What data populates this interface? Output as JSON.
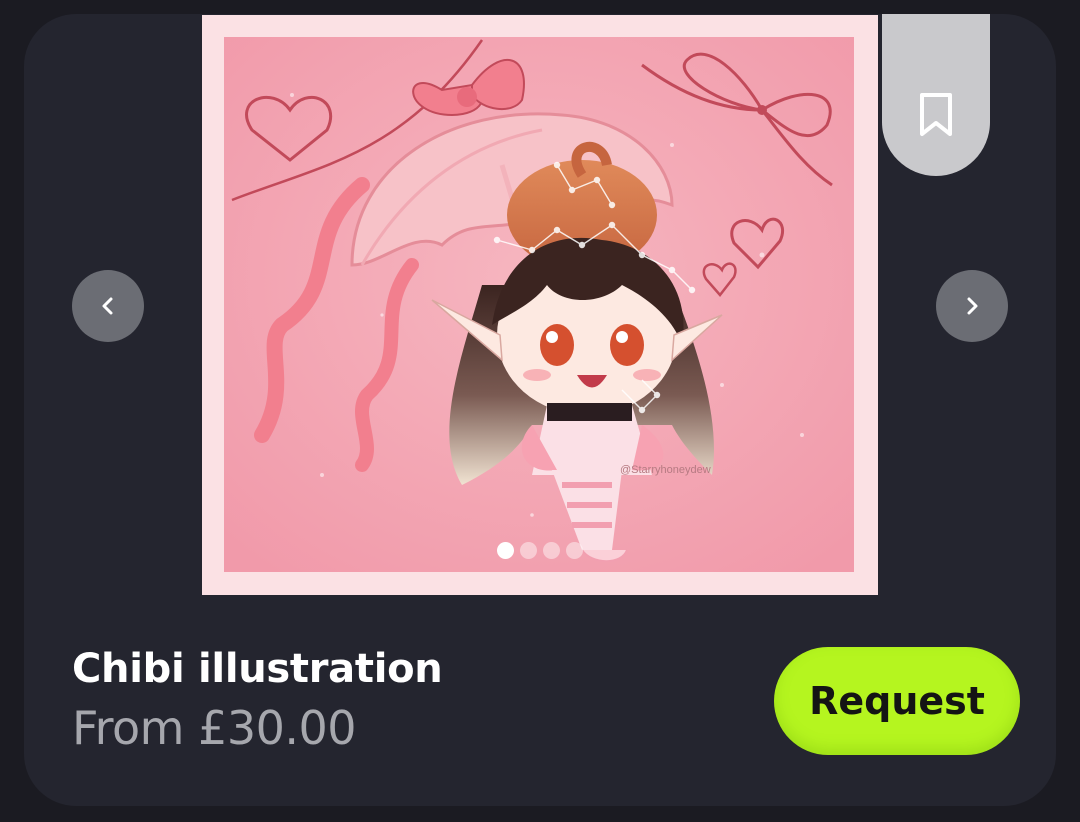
{
  "listing": {
    "title": "Chibi illustration",
    "price": "From £30.00",
    "request_label": "Request",
    "accent_color": "#b5f51f"
  },
  "gallery": {
    "image_alt": "Chibi girl with pink umbrella and bows",
    "watermark": "@Starryhoneydew",
    "slide_count": 4,
    "active_slide": 1
  },
  "icons": {
    "prev": "chevron-left-icon",
    "next": "chevron-right-icon",
    "bookmark": "bookmark-icon"
  }
}
